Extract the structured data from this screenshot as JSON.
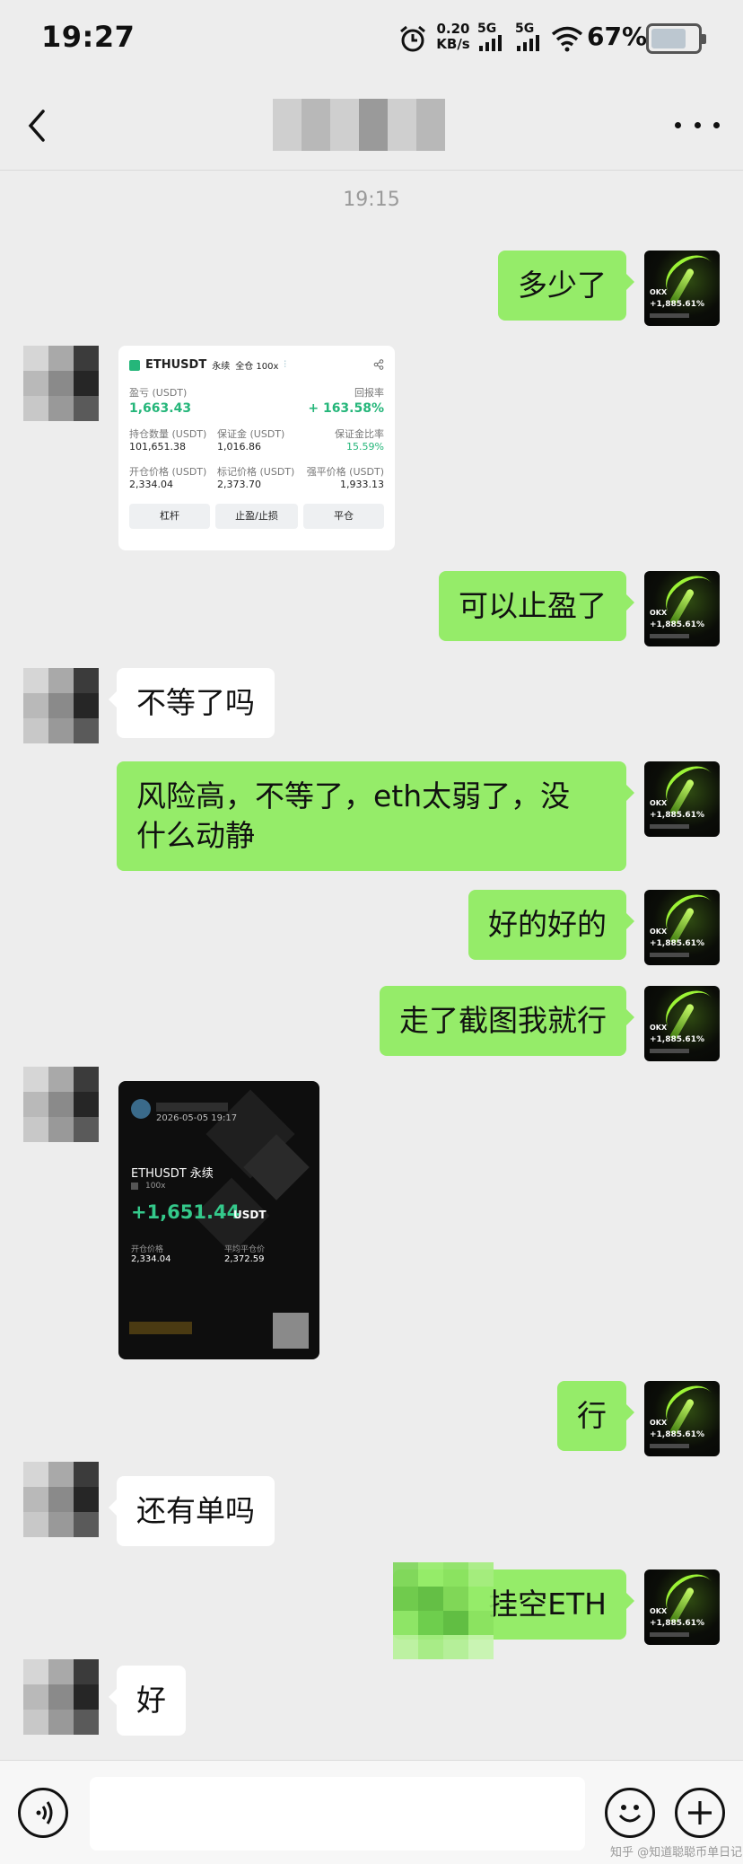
{
  "status_bar": {
    "time": "19:27",
    "net_speed_value": "0.20",
    "net_speed_unit": "KB/s",
    "signal_1": "5G",
    "signal_2": "5G",
    "battery": "67%"
  },
  "header": {
    "timestamp": "19:15"
  },
  "messages": [
    {
      "side": "out",
      "text": "多少了"
    },
    {
      "side": "in",
      "type": "position-card"
    },
    {
      "side": "out",
      "text": "可以止盈了"
    },
    {
      "side": "in",
      "text": "不等了吗"
    },
    {
      "side": "out",
      "line1": "风险高，不等了，eth太弱了，没",
      "line2": "什么动静"
    },
    {
      "side": "out",
      "text": "好的好的"
    },
    {
      "side": "out",
      "text": "走了截图我就行"
    },
    {
      "side": "in",
      "type": "share-card"
    },
    {
      "side": "out",
      "text": "行"
    },
    {
      "side": "in",
      "text": "还有单吗"
    },
    {
      "side": "out",
      "text": "挂空ETH"
    },
    {
      "side": "in",
      "text": "好"
    }
  ],
  "avatar_out": {
    "brand": "OKX",
    "gain": "+1,885.61%"
  },
  "position_card": {
    "symbol": "ETHUSDT",
    "type_tag": "永续",
    "mode_tag": "全仓 100x",
    "pnl_label": "盈亏 (USDT)",
    "pnl_value": "1,663.43",
    "roi_label": "回报率",
    "roi_value": "+ 163.58%",
    "qty_label": "持仓数量 (USDT)",
    "qty_value": "101,651.38",
    "margin_label": "保证金 (USDT)",
    "margin_value": "1,016.86",
    "margin_ratio_label": "保证金比率",
    "margin_ratio_value": "15.59%",
    "entry_label": "开仓价格 (USDT)",
    "entry_value": "2,334.04",
    "mark_label": "标记价格 (USDT)",
    "mark_value": "2,373.70",
    "liq_label": "强平价格 (USDT)",
    "liq_value": "1,933.13",
    "btn_leverage": "杠杆",
    "btn_tpsl": "止盈/止损",
    "btn_close": "平仓"
  },
  "share_card": {
    "date": "2026-05-05 19:17",
    "symbol": "ETHUSDT 永续",
    "leverage": "100x",
    "pnl": "+1,651.44",
    "pnl_unit": "USDT",
    "entry_label": "开仓价格",
    "entry_value": "2,334.04",
    "avg_close_label": "平均平仓价",
    "avg_close_value": "2,372.59"
  },
  "footer": {
    "watermark": "知乎 @知道聪聪币单日记"
  },
  "colors": {
    "bubble_out": "#95ec69",
    "bubble_in": "#ffffff",
    "background": "#ededed",
    "profit_green": "#25b67a"
  }
}
